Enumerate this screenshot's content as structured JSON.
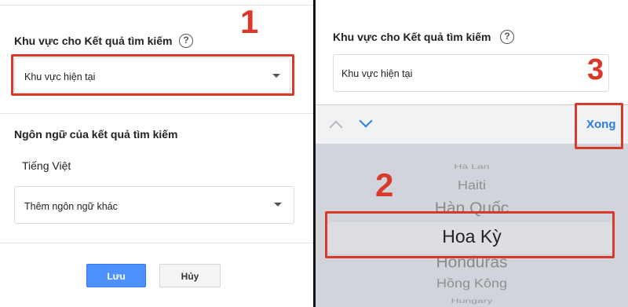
{
  "left": {
    "region_title": "Khu vực cho Kết quả tìm kiếm",
    "help_symbol": "?",
    "region_select_value": "Khu vực hiện tại",
    "language_title": "Ngôn ngữ của kết quả tìm kiếm",
    "current_language": "Tiếng Việt",
    "add_language_select": "Thêm ngôn ngữ khác",
    "save_label": "Lưu",
    "cancel_label": "Hủy",
    "step_label": "1"
  },
  "right": {
    "region_title": "Khu vực cho Kết quả tìm kiếm",
    "help_symbol": "?",
    "region_input_value": "Khu vực hiện tại",
    "done_label": "Xong",
    "step_done_label": "3",
    "step_picker_label": "2",
    "picker_items": [
      {
        "label": "Hà Lan",
        "style": "far"
      },
      {
        "label": "Haiti",
        "style": "near"
      },
      {
        "label": "Hàn Quốc",
        "style": "adjacent"
      },
      {
        "label": "Hoa Kỳ",
        "style": "selected"
      },
      {
        "label": "Honduras",
        "style": "adjacent"
      },
      {
        "label": "Hồng Kông",
        "style": "near"
      },
      {
        "label": "Hungary",
        "style": "far"
      }
    ]
  },
  "colors": {
    "annotation_red": "#d9392a",
    "primary_button": "#4d90fe",
    "done_blue": "#2a7de1",
    "picker_bg": "#d1d4da"
  }
}
